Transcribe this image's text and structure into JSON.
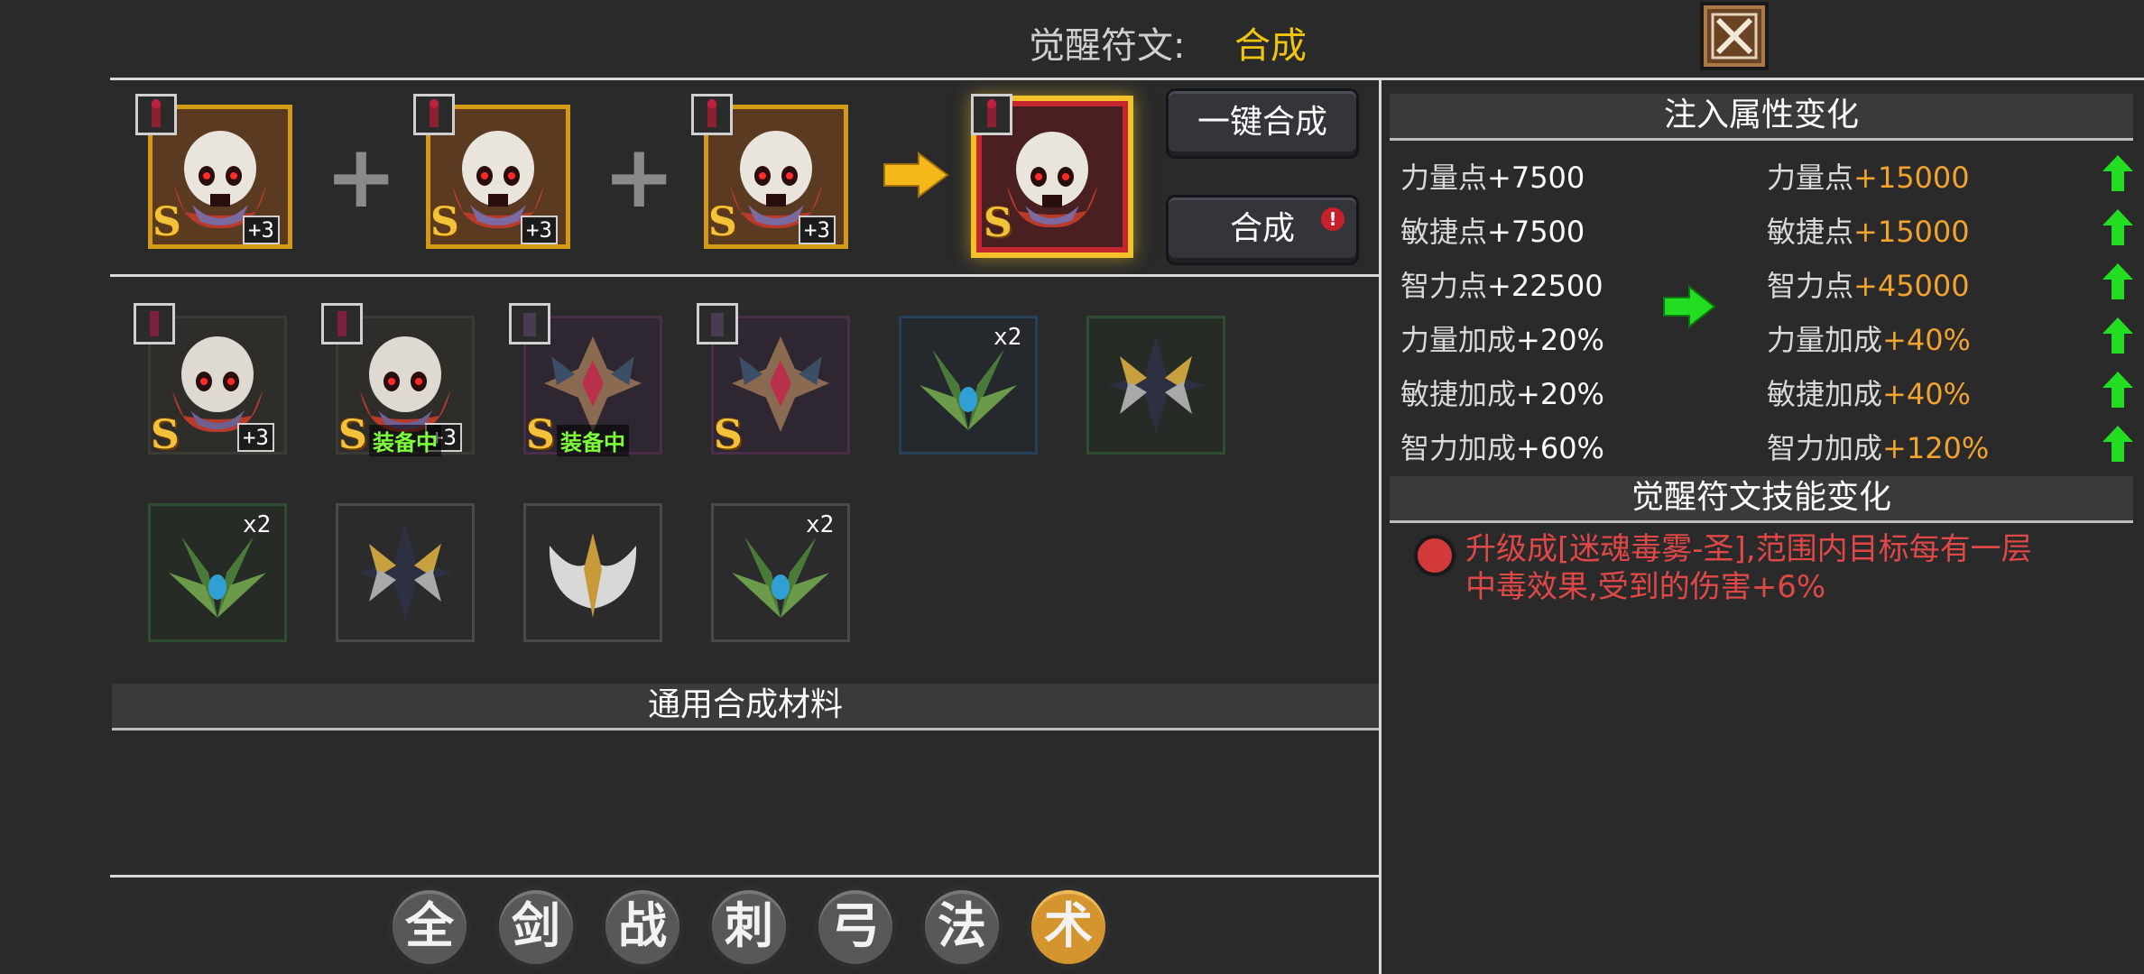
{
  "header": {
    "label": "觉醒符文:",
    "value": "合成"
  },
  "merge_row": {
    "input_plus_labels": [
      "+3",
      "+3",
      "+3"
    ],
    "rank": "S",
    "result_rank": "S"
  },
  "buttons": {
    "one_click": "一键合成",
    "compose": "合成",
    "compose_alert": "!"
  },
  "inventory": {
    "row1": [
      {
        "rank": "S",
        "plus": "+3",
        "equipped": "",
        "qty": ""
      },
      {
        "rank": "S",
        "plus": "+3",
        "equipped": "装备中",
        "qty": ""
      },
      {
        "rank": "S",
        "plus": "",
        "equipped": "装备中",
        "qty": ""
      },
      {
        "rank": "S",
        "plus": "",
        "equipped": "",
        "qty": ""
      },
      {
        "rank": "",
        "plus": "",
        "equipped": "",
        "qty": "x2"
      },
      {
        "rank": "",
        "plus": "",
        "equipped": "",
        "qty": ""
      }
    ],
    "row2": [
      {
        "qty": "x2"
      },
      {
        "qty": ""
      },
      {
        "qty": ""
      },
      {
        "qty": "x2"
      }
    ]
  },
  "materials": {
    "title": "通用合成材料"
  },
  "stats_panel": {
    "title": "注入属性变化",
    "current": [
      {
        "name": "力量点",
        "value": "+7500"
      },
      {
        "name": "敏捷点",
        "value": "+7500"
      },
      {
        "name": "智力点",
        "value": "+22500"
      },
      {
        "name": "力量加成",
        "value": "+20%"
      },
      {
        "name": "敏捷加成",
        "value": "+20%"
      },
      {
        "name": "智力加成",
        "value": "+60%"
      }
    ],
    "next": [
      {
        "name": "力量点",
        "value": "+15000"
      },
      {
        "name": "敏捷点",
        "value": "+15000"
      },
      {
        "name": "智力点",
        "value": "+45000"
      },
      {
        "name": "力量加成",
        "value": "+40%"
      },
      {
        "name": "敏捷加成",
        "value": "+40%"
      },
      {
        "name": "智力加成",
        "value": "+120%"
      }
    ]
  },
  "skill_panel": {
    "title": "觉醒符文技能变化",
    "line1": "升级成[迷魂毒雾-圣],范围内目标每有一层",
    "line2": "中毒效果,受到的伤害+6%"
  },
  "categories": [
    "全",
    "剑",
    "战",
    "刺",
    "弓",
    "法",
    "术"
  ],
  "active_category": "术",
  "colors": {
    "accent_gold": "#f1c40f",
    "value_orange": "#f2a22e",
    "skill_red": "#e04848",
    "up_green": "#22dd22"
  }
}
